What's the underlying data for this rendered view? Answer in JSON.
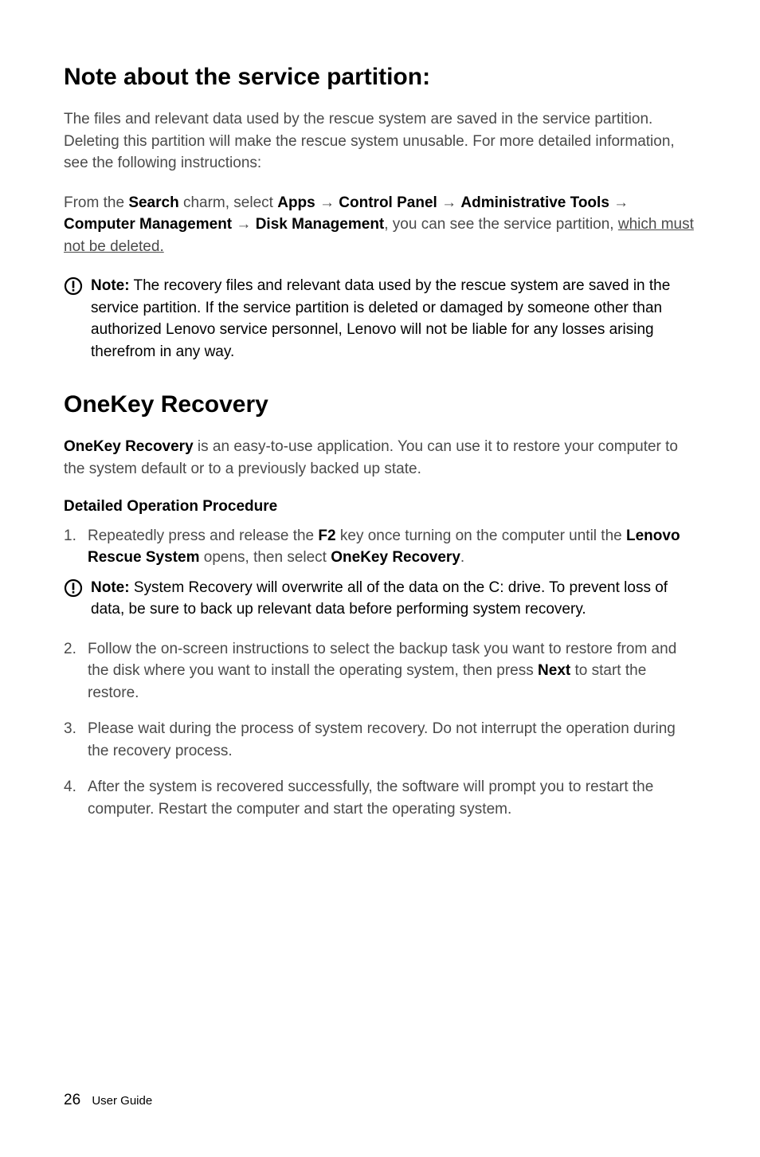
{
  "heading1": "Note about the service partition:",
  "p1": "The files and relevant data used by the rescue system are saved in the service partition. Deleting this partition will make the rescue system unusable. For more detailed information, see the following instructions:",
  "p2_intro": "From the ",
  "p2_search": "Search",
  "p2_mid1": " charm, select ",
  "p2_apps": "Apps",
  "p2_arrow": " → ",
  "p2_cp": "Control Panel",
  "p2_at": "Administrative Tools",
  "p2_cm": "Computer Management",
  "p2_dm": "Disk Management",
  "p2_tail": ", you can see the service partition, ",
  "p2_underline": "which must not be deleted.",
  "note1_label": "Note:",
  "note1_text": " The recovery files and relevant data used by the rescue system are saved in the service partition. If the service partition is deleted or damaged by someone other than authorized Lenovo service personnel, Lenovo will not be liable for any losses arising therefrom in any way.",
  "heading2": "OneKey Recovery",
  "p3_bold": "OneKey Recovery",
  "p3_rest": " is an easy-to-use application. You can use it to restore your computer to the system default or to a previously backed up state.",
  "subheading": "Detailed Operation Procedure",
  "step1_a": "Repeatedly press and release the ",
  "step1_f2": "F2",
  "step1_b": " key once turning on the computer until the ",
  "step1_lrs": "Lenovo Rescue System",
  "step1_c": " opens, then select ",
  "step1_okr": "OneKey Recovery",
  "step1_d": ".",
  "note2_label": "Note:",
  "note2_text": " System Recovery will overwrite all of the data on the C: drive. To prevent loss of data, be sure to back up relevant data before performing system recovery.",
  "step2_a": "Follow the on-screen instructions to select the backup task you want to restore from and the disk where you want to install the operating system, then press ",
  "step2_next": "Next",
  "step2_b": " to start the restore.",
  "step3": "Please wait during the process of system recovery. Do not interrupt the operation during the recovery process.",
  "step4": "After the system is recovered successfully, the software will prompt you to restart the computer. Restart the computer and start the operating system.",
  "page_number": "26",
  "footer_label": "User Guide"
}
